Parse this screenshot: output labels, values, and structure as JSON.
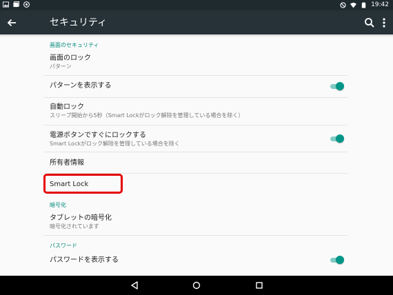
{
  "status_bar": {
    "time": "19:42",
    "left_icons": [
      "image-icon",
      "gallery-icon",
      "android-icon"
    ],
    "right_icons": [
      "block-icon",
      "wifi-icon",
      "battery-icon"
    ]
  },
  "app_bar": {
    "title": "セキュリティ",
    "icons": [
      "back-arrow-icon",
      "search-icon",
      "more-vert-icon"
    ]
  },
  "sections": {
    "screen_security": {
      "header": "画面のセキュリティ",
      "items": {
        "screen_lock": {
          "title": "画面のロック",
          "summary": "パターン"
        },
        "show_pattern": {
          "title": "パターンを表示する",
          "toggle": true
        },
        "auto_lock": {
          "title": "自動ロック",
          "summary": "スリープ開始から5秒（Smart Lockがロック解除を管理している場合を除く）"
        },
        "power_lock": {
          "title": "電源ボタンですぐにロックする",
          "summary": "Smart Lockがロック解除を管理している場合を除く",
          "toggle": true
        },
        "owner_info": {
          "title": "所有者情報"
        },
        "smart_lock": {
          "title": "Smart Lock"
        }
      }
    },
    "encryption": {
      "header": "暗号化",
      "items": {
        "tablet_encrypt": {
          "title": "タブレットの暗号化",
          "summary": "暗号化されています"
        }
      }
    },
    "password": {
      "header": "パスワード",
      "items": {
        "show_password": {
          "title": "パスワードを表示する",
          "toggle": true
        }
      }
    }
  },
  "colors": {
    "app_bar": "#263238",
    "status_bar": "#1f2a2f",
    "accent": "#009688",
    "highlight": "#e60000"
  }
}
